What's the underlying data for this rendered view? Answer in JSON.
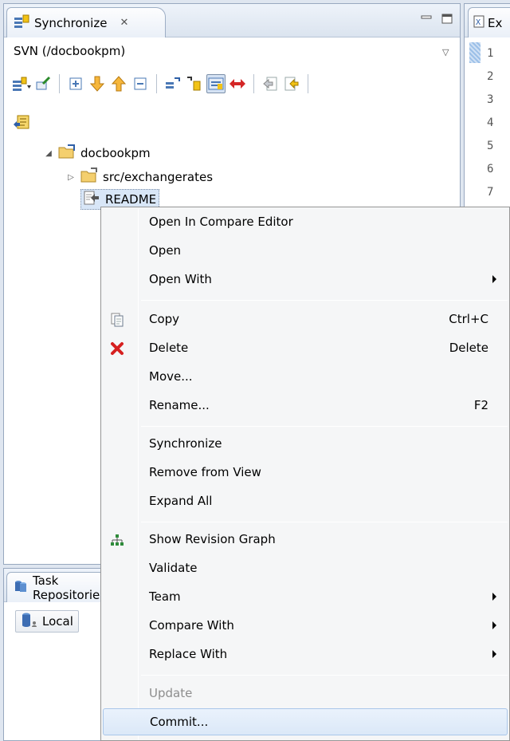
{
  "sync_view": {
    "tab_title": "Synchronize",
    "tab_close_glyph": "✕",
    "source_label": "SVN (/docbookpm)",
    "dropdown_glyph": "▽"
  },
  "tree": {
    "root_label": "docbookpm",
    "folder_label": "src/exchangerates",
    "file_label": "README"
  },
  "task_view": {
    "tab_title": "Task Repositories",
    "local_label": "Local"
  },
  "editor": {
    "tab_label": "Ex",
    "line_numbers": [
      "1",
      "2",
      "3",
      "4",
      "5",
      "6",
      "7"
    ]
  },
  "context_menu": {
    "items": [
      {
        "label": "Open In Compare Editor"
      },
      {
        "label": "Open"
      },
      {
        "label": "Open With"
      },
      {
        "label": "Copy",
        "accelerator": "Ctrl+C",
        "icon": "copy-icon"
      },
      {
        "label": "Delete",
        "accelerator": "Delete",
        "icon": "delete-icon"
      },
      {
        "label": "Move..."
      },
      {
        "label": "Rename...",
        "accelerator": "F2"
      },
      {
        "label": "Synchronize"
      },
      {
        "label": "Remove from View"
      },
      {
        "label": "Expand All"
      },
      {
        "label": "Show Revision Graph",
        "icon": "revision-graph-icon"
      },
      {
        "label": "Validate"
      },
      {
        "label": "Team"
      },
      {
        "label": "Compare With"
      },
      {
        "label": "Replace With"
      },
      {
        "label": "Update",
        "state": "disabled"
      },
      {
        "label": "Commit...",
        "state": "highlighted"
      }
    ]
  },
  "colors": {
    "view_border": "#98a8bf",
    "selection_bg": "#d8e6f7",
    "menu_bg": "#f5f6f7",
    "menu_hover_border": "#a9c6ea",
    "delete_red": "#d62020"
  }
}
